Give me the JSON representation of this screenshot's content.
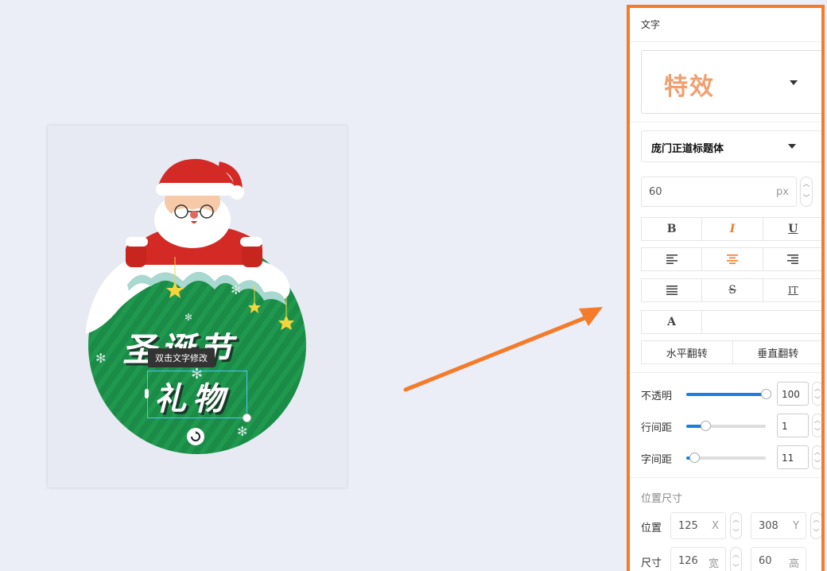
{
  "canvas": {
    "headline_text": "圣诞节",
    "selected_text": "礼物",
    "tooltip": "双击文字修改"
  },
  "panel": {
    "title": "文字",
    "effect_label": "特效",
    "font_name": "庞门正道标题体",
    "font_size": {
      "value": "60",
      "unit": "px"
    },
    "style_buttons": [
      "B",
      "I",
      "U"
    ],
    "align_buttons": [
      "align-left-icon",
      "align-center-icon",
      "align-right-icon"
    ],
    "misc_buttons": [
      "justify-icon",
      "S",
      "IT"
    ],
    "color_button": "A",
    "flip": {
      "horizontal": "水平翻转",
      "vertical": "垂直翻转"
    },
    "sliders": [
      {
        "label": "不透明",
        "value": "100",
        "fraction": 1.0
      },
      {
        "label": "行间距",
        "value": "1",
        "fraction": 0.25
      },
      {
        "label": "字间距",
        "value": "11",
        "fraction": 0.11
      }
    ],
    "position_section": "位置尺寸",
    "position": {
      "label": "位置",
      "x": "125",
      "x_unit": "X",
      "y": "308",
      "y_unit": "Y"
    },
    "size": {
      "label": "尺寸",
      "w": "126",
      "w_unit": "宽",
      "h": "60",
      "h_unit": "高"
    }
  },
  "colors": {
    "accent": "#f47b2a",
    "slider": "#1e7ee0",
    "active_icon": "#f47b2a"
  }
}
